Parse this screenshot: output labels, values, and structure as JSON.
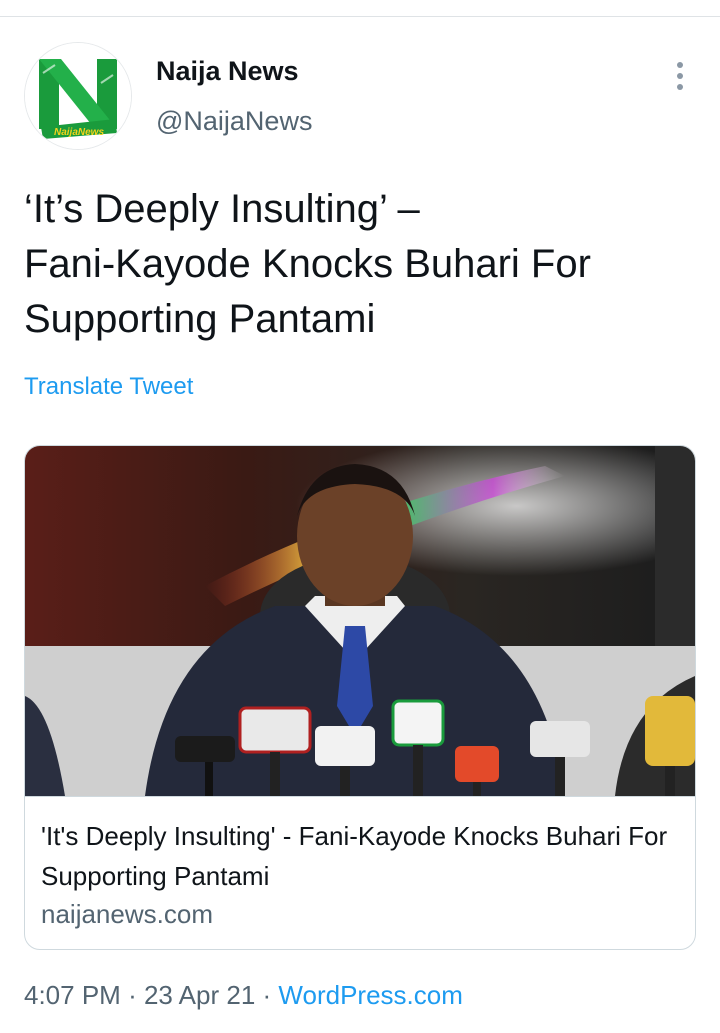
{
  "tweet": {
    "author": {
      "name": "Naija News",
      "handle": "@NaijaNews",
      "avatar_icon": "naija-news-logo-icon",
      "logo_text": "NaijaNews"
    },
    "text": "‘It’s Deeply Insulting’ –\nFani-Kayode Knocks Buhari For\nSupporting Pantami",
    "translate_label": "Translate Tweet",
    "card": {
      "title": "'It's Deeply Insulting' - Fani-Kayode Knocks Buhari For Supporting Pantami",
      "domain": "naijanews.com",
      "image_icon": "press-conference-photo"
    },
    "time": "4:07 PM",
    "separator": "·",
    "date": "23 Apr 21",
    "source": "WordPress.com"
  },
  "colors": {
    "link": "#1d9bf0",
    "secondary_text": "#536471",
    "brand_green": "#1a9b3c"
  }
}
